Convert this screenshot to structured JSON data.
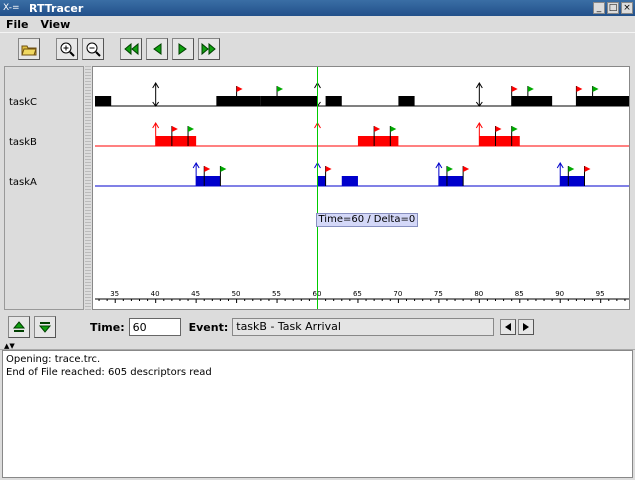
{
  "window": {
    "title": "RTTracer",
    "sys_label": "X-="
  },
  "menu": {
    "file": "File",
    "view": "View"
  },
  "toolbar": {
    "icons": [
      "open-folder-icon",
      "zoom-in-icon",
      "zoom-out-icon",
      "rewind-icon",
      "step-back-icon",
      "step-forward-icon",
      "fast-forward-icon"
    ]
  },
  "tasks": [
    {
      "name": "taskC",
      "color": "#000000"
    },
    {
      "name": "taskB",
      "color": "#ff0000"
    },
    {
      "name": "taskA",
      "color": "#0000cc"
    }
  ],
  "chart_data": {
    "type": "gantt",
    "x_ticks": [
      "35",
      "40",
      "45",
      "50",
      "55",
      "60",
      "65",
      "70",
      "75",
      "80",
      "85",
      "90",
      "95"
    ],
    "xlim": [
      32.5,
      98.5
    ],
    "cursor_time": 60,
    "tooltip": "Time=60 / Delta=0",
    "series": [
      {
        "task": "taskC",
        "intervals": [
          [
            32.5,
            34.5
          ],
          [
            47.5,
            53
          ],
          [
            53,
            60
          ],
          [
            61,
            63
          ],
          [
            70,
            72
          ],
          [
            84,
            89
          ],
          [
            92,
            98.5
          ]
        ],
        "arrivals": [
          40,
          60,
          80
        ],
        "flags": [
          50,
          55,
          84,
          86,
          92,
          94
        ]
      },
      {
        "task": "taskB",
        "intervals": [
          [
            40,
            45
          ],
          [
            65,
            70
          ],
          [
            80,
            85
          ]
        ],
        "arrivals": [
          40,
          60,
          80
        ],
        "flags": [
          42,
          44,
          67,
          69,
          82,
          84
        ]
      },
      {
        "task": "taskA",
        "intervals": [
          [
            45,
            48
          ],
          [
            60,
            61
          ],
          [
            63,
            65
          ],
          [
            75,
            78
          ],
          [
            90,
            93
          ]
        ],
        "arrivals": [
          45,
          60,
          75,
          90
        ],
        "flags": [
          46,
          48,
          61,
          76,
          78,
          91,
          93
        ]
      }
    ]
  },
  "bottom": {
    "time_label": "Time:",
    "time_value": "60",
    "event_label": "Event:",
    "event_value": "taskB - Task Arrival"
  },
  "console": {
    "lines": [
      "Opening: trace.trc.",
      "End of File reached: 605 descriptors read"
    ]
  }
}
